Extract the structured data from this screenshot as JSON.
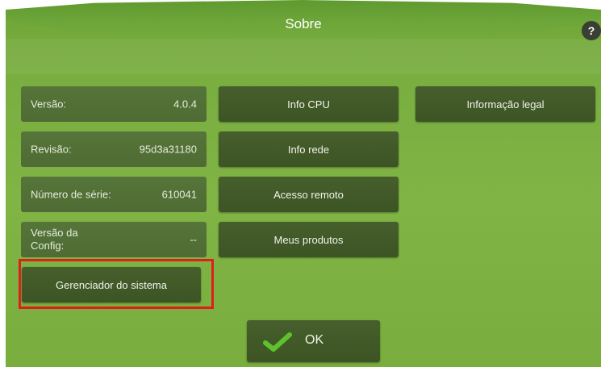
{
  "header": {
    "title": "Sobre",
    "help_label": "?"
  },
  "info": {
    "version": {
      "label": "Versão:",
      "value": "4.0.4"
    },
    "revision": {
      "label": "Revisão:",
      "value": "95d3a31180"
    },
    "serial": {
      "label": "Número de série:",
      "value": "610041"
    },
    "config_version": {
      "label_line1": "Versão da",
      "label_line2": "Config:",
      "value": "--"
    }
  },
  "buttons": {
    "cpu_info": "Info CPU",
    "network_info": "Info rede",
    "remote_access": "Acesso remoto",
    "my_products": "Meus produtos",
    "legal_info": "Informação legal",
    "system_manager": "Gerenciador do sistema",
    "ok": "OK"
  },
  "colors": {
    "background": "#80b445",
    "button": "#435f27",
    "highlight": "#e11d1d",
    "check": "#5fc12d"
  }
}
